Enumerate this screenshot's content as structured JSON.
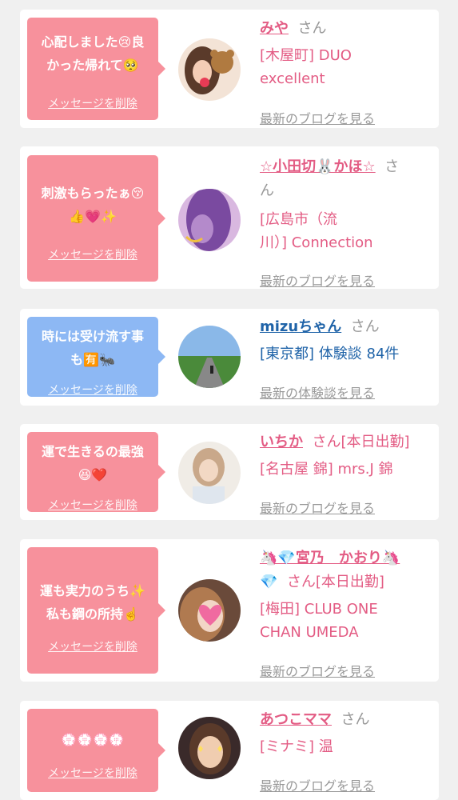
{
  "colors": {
    "pink_bubble": "#f7919c",
    "blue_bubble": "#8db8f4",
    "pink_text": "#e35c84",
    "blue_text": "#1f63a8",
    "background": "#f0f0f0"
  },
  "cards": [
    {
      "message_line1": "心配しました😢良",
      "message_line2": "かった帰れて🥺",
      "delete_label": "メッセージを削除",
      "name": "みや",
      "san": "さん",
      "shop_line1": "[木屋町] DUO",
      "shop_line2": "excellent",
      "more_label": "最新のブログを見る",
      "avatar_icon": "girl-with-bear-photo"
    },
    {
      "message_line1": "刺激もらったぁ😚",
      "message_line2": "👍💗✨",
      "delete_label": "メッセージを削除",
      "name": "☆小田切🐰かほ☆",
      "san": "さ",
      "san_wrap": "ん",
      "shop_line1": "[広島市（流",
      "shop_line2": "川）] Connection",
      "more_label": "最新のブログを見る",
      "avatar_icon": "purple-hair-photo"
    },
    {
      "message_line1": "時には受け流す事",
      "message_line2": "も🈶🐜",
      "delete_label": "メッセージを削除",
      "name": "mizuちゃん",
      "san": "さん",
      "shop_line1": "[東京都] 体験談 84件",
      "more_label": "最新の体験談を見る",
      "avatar_icon": "road-landscape-photo"
    },
    {
      "message_line1": "運で生きるの最強",
      "message_line2": "😆❤️",
      "delete_label": "メッセージを削除",
      "name": "いちか",
      "san": "さん[本日出勤]",
      "shop_line1": "[名古屋 錦] mrs.J 錦",
      "more_label": "最新のブログを見る",
      "avatar_icon": "woman-photo"
    },
    {
      "message_line1": "運も実力のうち✨",
      "message_line2": "私も鋼の所持☝️",
      "delete_label": "メッセージを削除",
      "name": "🦄💎宮乃　かおり🦄",
      "name_wrap": "💎",
      "san": "さん[本日出勤]",
      "shop_line1": "[梅田] CLUB ONE",
      "shop_line2": "CHAN UMEDA",
      "more_label": "最新のブログを見る",
      "avatar_icon": "heart-sticker-photo"
    },
    {
      "message_line1": "💮💮💮💮",
      "delete_label": "メッセージを削除",
      "name": "あつこママ",
      "san": "さん",
      "shop_line1": "[ミナミ] 温",
      "more_label": "最新のブログを見る",
      "avatar_icon": "sparkle-face-photo"
    }
  ]
}
